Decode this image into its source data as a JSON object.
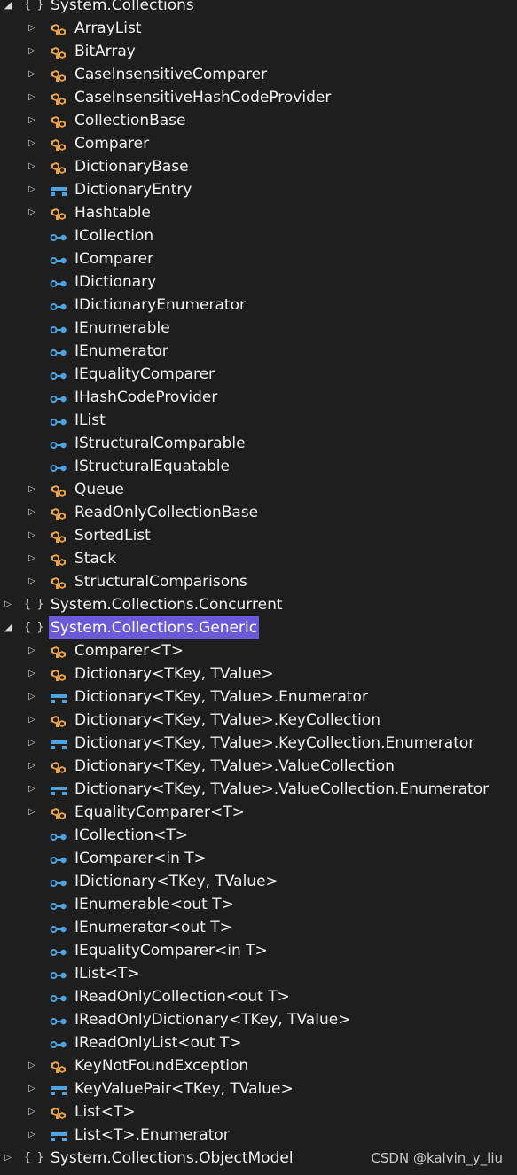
{
  "tree": [
    {
      "depth": 0,
      "expanded": true,
      "arrow": true,
      "icon": "namespace-icon",
      "label": "System.Collections"
    },
    {
      "depth": 1,
      "expanded": false,
      "arrow": true,
      "icon": "class-icon",
      "label": "ArrayList"
    },
    {
      "depth": 1,
      "expanded": false,
      "arrow": true,
      "icon": "class-icon",
      "label": "BitArray"
    },
    {
      "depth": 1,
      "expanded": false,
      "arrow": true,
      "icon": "class-icon",
      "label": "CaseInsensitiveComparer"
    },
    {
      "depth": 1,
      "expanded": false,
      "arrow": true,
      "icon": "class-icon",
      "label": "CaseInsensitiveHashCodeProvider"
    },
    {
      "depth": 1,
      "expanded": false,
      "arrow": true,
      "icon": "class-icon",
      "label": "CollectionBase"
    },
    {
      "depth": 1,
      "expanded": false,
      "arrow": true,
      "icon": "class-icon",
      "label": "Comparer"
    },
    {
      "depth": 1,
      "expanded": false,
      "arrow": true,
      "icon": "class-icon",
      "label": "DictionaryBase"
    },
    {
      "depth": 1,
      "expanded": false,
      "arrow": true,
      "icon": "struct-icon",
      "label": "DictionaryEntry"
    },
    {
      "depth": 1,
      "expanded": false,
      "arrow": true,
      "icon": "class-icon",
      "label": "Hashtable"
    },
    {
      "depth": 1,
      "expanded": false,
      "arrow": false,
      "icon": "interface-icon",
      "label": "ICollection"
    },
    {
      "depth": 1,
      "expanded": false,
      "arrow": false,
      "icon": "interface-icon",
      "label": "IComparer"
    },
    {
      "depth": 1,
      "expanded": false,
      "arrow": false,
      "icon": "interface-icon",
      "label": "IDictionary"
    },
    {
      "depth": 1,
      "expanded": false,
      "arrow": false,
      "icon": "interface-icon",
      "label": "IDictionaryEnumerator"
    },
    {
      "depth": 1,
      "expanded": false,
      "arrow": false,
      "icon": "interface-icon",
      "label": "IEnumerable"
    },
    {
      "depth": 1,
      "expanded": false,
      "arrow": false,
      "icon": "interface-icon",
      "label": "IEnumerator"
    },
    {
      "depth": 1,
      "expanded": false,
      "arrow": false,
      "icon": "interface-icon",
      "label": "IEqualityComparer"
    },
    {
      "depth": 1,
      "expanded": false,
      "arrow": false,
      "icon": "interface-icon",
      "label": "IHashCodeProvider"
    },
    {
      "depth": 1,
      "expanded": false,
      "arrow": false,
      "icon": "interface-icon",
      "label": "IList"
    },
    {
      "depth": 1,
      "expanded": false,
      "arrow": false,
      "icon": "interface-icon",
      "label": "IStructuralComparable"
    },
    {
      "depth": 1,
      "expanded": false,
      "arrow": false,
      "icon": "interface-icon",
      "label": "IStructuralEquatable"
    },
    {
      "depth": 1,
      "expanded": false,
      "arrow": true,
      "icon": "class-icon",
      "label": "Queue"
    },
    {
      "depth": 1,
      "expanded": false,
      "arrow": true,
      "icon": "class-icon",
      "label": "ReadOnlyCollectionBase"
    },
    {
      "depth": 1,
      "expanded": false,
      "arrow": true,
      "icon": "class-icon",
      "label": "SortedList"
    },
    {
      "depth": 1,
      "expanded": false,
      "arrow": true,
      "icon": "class-icon",
      "label": "Stack"
    },
    {
      "depth": 1,
      "expanded": false,
      "arrow": true,
      "icon": "class-icon",
      "label": "StructuralComparisons"
    },
    {
      "depth": 0,
      "expanded": false,
      "arrow": true,
      "icon": "namespace-icon",
      "label": "System.Collections.Concurrent"
    },
    {
      "depth": 0,
      "expanded": true,
      "arrow": true,
      "icon": "namespace-icon",
      "label": "System.Collections.Generic",
      "selected": true
    },
    {
      "depth": 1,
      "expanded": false,
      "arrow": true,
      "icon": "class-icon",
      "label": "Comparer<T>"
    },
    {
      "depth": 1,
      "expanded": false,
      "arrow": true,
      "icon": "class-icon",
      "label": "Dictionary<TKey, TValue>"
    },
    {
      "depth": 1,
      "expanded": false,
      "arrow": true,
      "icon": "struct-icon",
      "label": "Dictionary<TKey, TValue>.Enumerator"
    },
    {
      "depth": 1,
      "expanded": false,
      "arrow": true,
      "icon": "class-icon",
      "label": "Dictionary<TKey, TValue>.KeyCollection"
    },
    {
      "depth": 1,
      "expanded": false,
      "arrow": true,
      "icon": "struct-icon",
      "label": "Dictionary<TKey, TValue>.KeyCollection.Enumerator"
    },
    {
      "depth": 1,
      "expanded": false,
      "arrow": true,
      "icon": "class-icon",
      "label": "Dictionary<TKey, TValue>.ValueCollection"
    },
    {
      "depth": 1,
      "expanded": false,
      "arrow": true,
      "icon": "struct-icon",
      "label": "Dictionary<TKey, TValue>.ValueCollection.Enumerator"
    },
    {
      "depth": 1,
      "expanded": false,
      "arrow": true,
      "icon": "class-icon",
      "label": "EqualityComparer<T>"
    },
    {
      "depth": 1,
      "expanded": false,
      "arrow": false,
      "icon": "interface-icon",
      "label": "ICollection<T>"
    },
    {
      "depth": 1,
      "expanded": false,
      "arrow": false,
      "icon": "interface-icon",
      "label": "IComparer<in T>"
    },
    {
      "depth": 1,
      "expanded": false,
      "arrow": false,
      "icon": "interface-icon",
      "label": "IDictionary<TKey, TValue>"
    },
    {
      "depth": 1,
      "expanded": false,
      "arrow": false,
      "icon": "interface-icon",
      "label": "IEnumerable<out T>"
    },
    {
      "depth": 1,
      "expanded": false,
      "arrow": false,
      "icon": "interface-icon",
      "label": "IEnumerator<out T>"
    },
    {
      "depth": 1,
      "expanded": false,
      "arrow": false,
      "icon": "interface-icon",
      "label": "IEqualityComparer<in T>"
    },
    {
      "depth": 1,
      "expanded": false,
      "arrow": false,
      "icon": "interface-icon",
      "label": "IList<T>"
    },
    {
      "depth": 1,
      "expanded": false,
      "arrow": false,
      "icon": "interface-icon",
      "label": "IReadOnlyCollection<out T>"
    },
    {
      "depth": 1,
      "expanded": false,
      "arrow": false,
      "icon": "interface-icon",
      "label": "IReadOnlyDictionary<TKey, TValue>"
    },
    {
      "depth": 1,
      "expanded": false,
      "arrow": false,
      "icon": "interface-icon",
      "label": "IReadOnlyList<out T>"
    },
    {
      "depth": 1,
      "expanded": false,
      "arrow": true,
      "icon": "class-icon",
      "label": "KeyNotFoundException"
    },
    {
      "depth": 1,
      "expanded": false,
      "arrow": true,
      "icon": "struct-icon",
      "label": "KeyValuePair<TKey, TValue>"
    },
    {
      "depth": 1,
      "expanded": false,
      "arrow": true,
      "icon": "class-icon",
      "label": "List<T>"
    },
    {
      "depth": 1,
      "expanded": false,
      "arrow": true,
      "icon": "struct-icon",
      "label": "List<T>.Enumerator"
    },
    {
      "depth": 0,
      "expanded": false,
      "arrow": true,
      "icon": "namespace-icon",
      "label": "System.Collections.ObjectModel"
    }
  ],
  "namespace_glyph": "{ }",
  "arrow_glyphs": {
    "expanded": "◢",
    "collapsed": "▷"
  },
  "colors": {
    "background": "#1e1e1e",
    "text": "#f1f1f1",
    "selection": "#6b5ad8",
    "class_icon": "#e8a24a",
    "struct_icon": "#4fa3e0",
    "interface_icon": "#4fa3e0"
  },
  "watermark": "CSDN @kalvin_y_liu"
}
